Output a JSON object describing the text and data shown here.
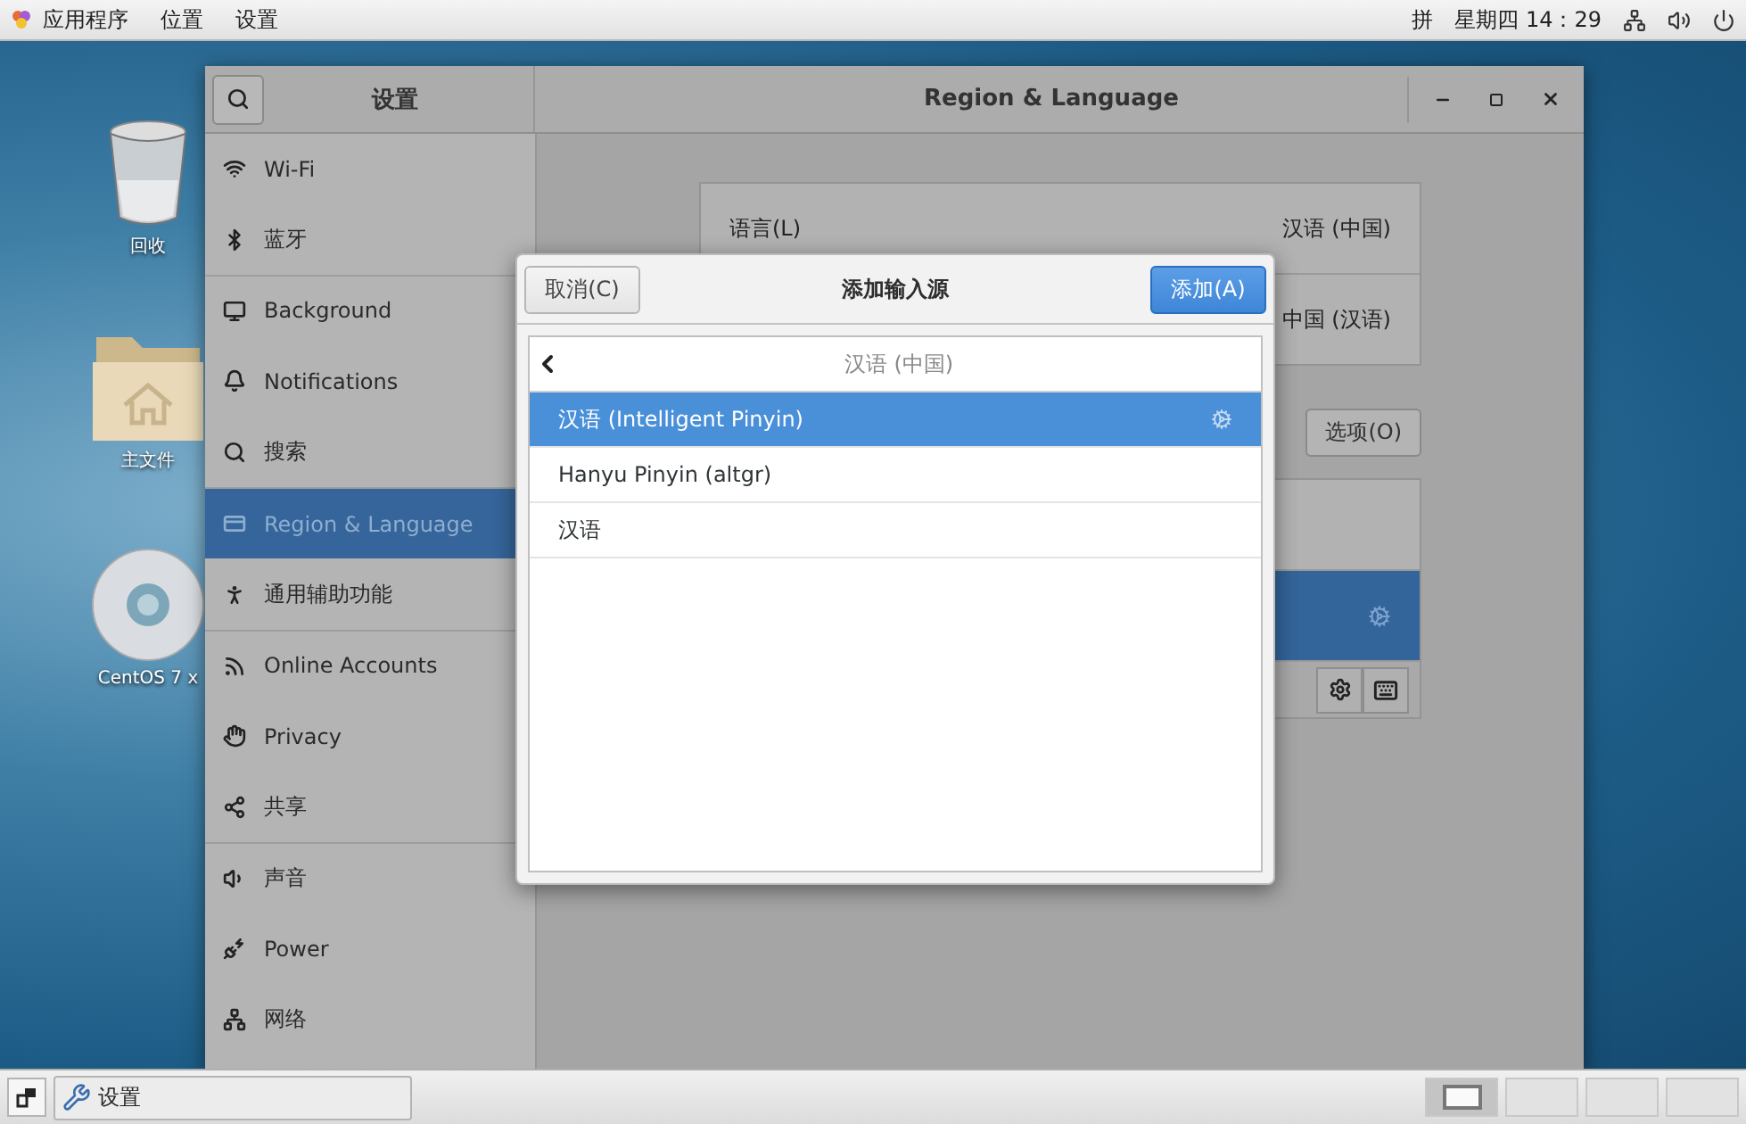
{
  "top_bar": {
    "menus": [
      "应用程序",
      "位置",
      "设置"
    ],
    "input_method": "拼",
    "clock": "星期四 14：29"
  },
  "desktop_icons": [
    {
      "kind": "trash",
      "label": "回收"
    },
    {
      "kind": "folder",
      "label": "主文件"
    },
    {
      "kind": "disc",
      "label": "CentOS 7 x"
    }
  ],
  "settings_window": {
    "sidebar_title": "设置",
    "title": "Region & Language",
    "sidebar_groups": [
      [
        {
          "kind": "wifi",
          "label": "Wi-Fi",
          "selected": false
        },
        {
          "kind": "bluetooth",
          "label": "蓝牙",
          "selected": false
        }
      ],
      [
        {
          "kind": "background",
          "label": "Background",
          "selected": false
        },
        {
          "kind": "notifications",
          "label": "Notifications",
          "selected": false
        },
        {
          "kind": "search",
          "label": "搜索",
          "selected": false
        }
      ],
      [
        {
          "kind": "region",
          "label": "Region & Language",
          "selected": true
        },
        {
          "kind": "accessibility",
          "label": "通用辅助功能",
          "selected": false
        }
      ],
      [
        {
          "kind": "accounts",
          "label": "Online Accounts",
          "selected": false
        },
        {
          "kind": "privacy",
          "label": "Privacy",
          "selected": false
        },
        {
          "kind": "sharing",
          "label": "共享",
          "selected": false
        }
      ],
      [
        {
          "kind": "sound",
          "label": "声音",
          "selected": false
        },
        {
          "kind": "power",
          "label": "Power",
          "selected": false
        },
        {
          "kind": "network",
          "label": "网络",
          "selected": false
        }
      ]
    ],
    "language_rows": [
      {
        "label": "语言(L)",
        "value": "汉语 (中国)"
      },
      {
        "value": "中国 (汉语)"
      }
    ],
    "options_button": "选项(O)",
    "input_sources": [
      {
        "selected": false,
        "configurable": false
      },
      {
        "selected": true,
        "configurable": true
      }
    ]
  },
  "dialog": {
    "cancel": "取消(C)",
    "title": "添加输入源",
    "add": "添加(A)",
    "back_header": "汉语 (中国)",
    "items": [
      {
        "label": "汉语 (Intelligent Pinyin)",
        "selected": true,
        "configurable": true
      },
      {
        "label": "Hanyu Pinyin (altgr)",
        "selected": false,
        "configurable": false
      },
      {
        "label": "汉语",
        "selected": false,
        "configurable": false
      }
    ]
  },
  "taskbar": {
    "tasks": [
      {
        "label": "设置"
      }
    ],
    "workspaces": [
      {
        "selected": true
      },
      {
        "selected": false
      },
      {
        "selected": false
      },
      {
        "selected": false
      }
    ]
  }
}
